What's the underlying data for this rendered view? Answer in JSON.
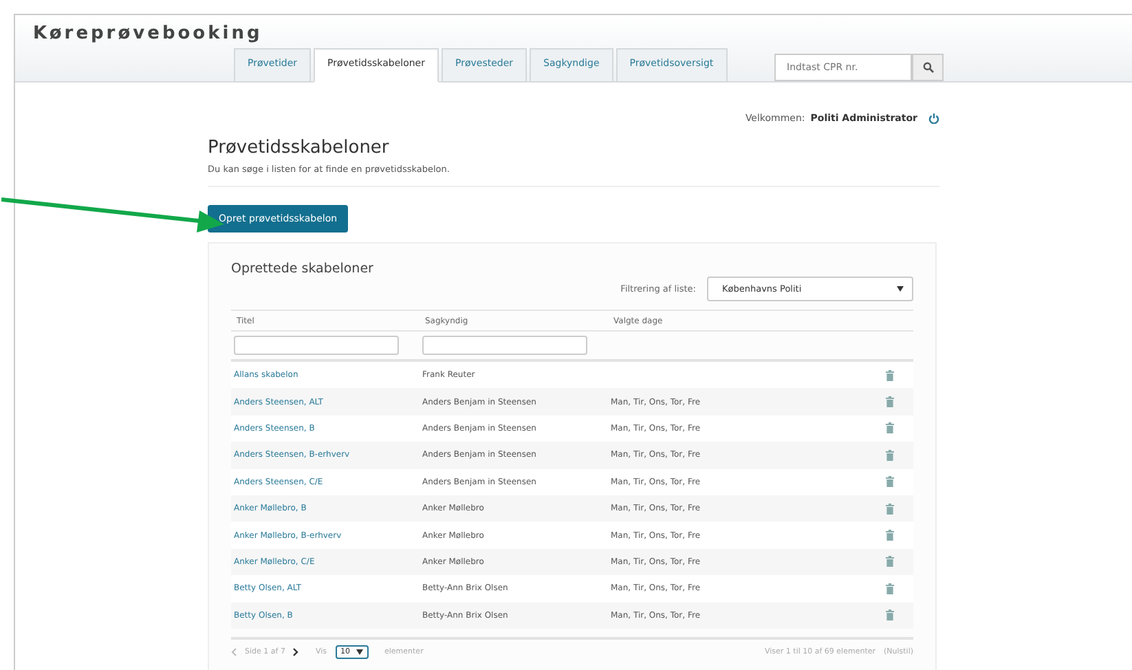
{
  "app_title": "Køreprøvebooking",
  "tabs": [
    {
      "label": "Prøvetider",
      "selected": false
    },
    {
      "label": "Prøvetidsskabeloner",
      "selected": true
    },
    {
      "label": "Prøvesteder",
      "selected": false
    },
    {
      "label": "Sagkyndige",
      "selected": false
    },
    {
      "label": "Prøvetidsoversigt",
      "selected": false
    }
  ],
  "search": {
    "placeholder": "Indtast CPR nr."
  },
  "welcome": {
    "label": "Velkommen:",
    "user": "Politi Administrator"
  },
  "page": {
    "title": "Prøvetidsskabeloner",
    "subtitle": "Du kan søge i listen for at finde en prøvetidsskabelon.",
    "create_button": "Opret prøvetidsskabelon"
  },
  "panel": {
    "title": "Oprettede skabeloner",
    "filter_label": "Filtrering af liste:",
    "filter_value": "Københavns Politi"
  },
  "columns": [
    "Titel",
    "Sagkyndig",
    "Valgte dage"
  ],
  "rows": [
    {
      "title": "Allans skabelon",
      "expert": "Frank Reuter",
      "days": ""
    },
    {
      "title": "Anders Steensen, ALT",
      "expert": "Anders Benjam in Steensen",
      "days": "Man, Tir, Ons, Tor, Fre"
    },
    {
      "title": "Anders Steensen, B",
      "expert": "Anders Benjam in Steensen",
      "days": "Man, Tir, Ons, Tor, Fre"
    },
    {
      "title": "Anders Steensen, B-erhverv",
      "expert": "Anders Benjam in Steensen",
      "days": "Man, Tir, Ons, Tor, Fre"
    },
    {
      "title": "Anders Steensen, C/E",
      "expert": "Anders Benjam in Steensen",
      "days": "Man, Tir, Ons, Tor, Fre"
    },
    {
      "title": "Anker Møllebro, B",
      "expert": "Anker Møllebro",
      "days": "Man, Tir, Ons, Tor, Fre"
    },
    {
      "title": "Anker Møllebro, B-erhverv",
      "expert": "Anker Møllebro",
      "days": "Man, Tir, Ons, Tor, Fre"
    },
    {
      "title": "Anker Møllebro, C/E",
      "expert": "Anker Møllebro",
      "days": "Man, Tir, Ons, Tor, Fre"
    },
    {
      "title": "Betty Olsen, ALT",
      "expert": "Betty-Ann Brix Olsen",
      "days": "Man, Tir, Ons, Tor, Fre"
    },
    {
      "title": "Betty Olsen, B",
      "expert": "Betty-Ann Brix Olsen",
      "days": "Man, Tir, Ons, Tor, Fre"
    }
  ],
  "pager": {
    "page": "Side 1 af 7",
    "show": "Vis",
    "page_size": "10",
    "unit": "elementer",
    "summary": "Viser 1 til 10 af 69 elementer",
    "reset": "(Nulstil)"
  }
}
